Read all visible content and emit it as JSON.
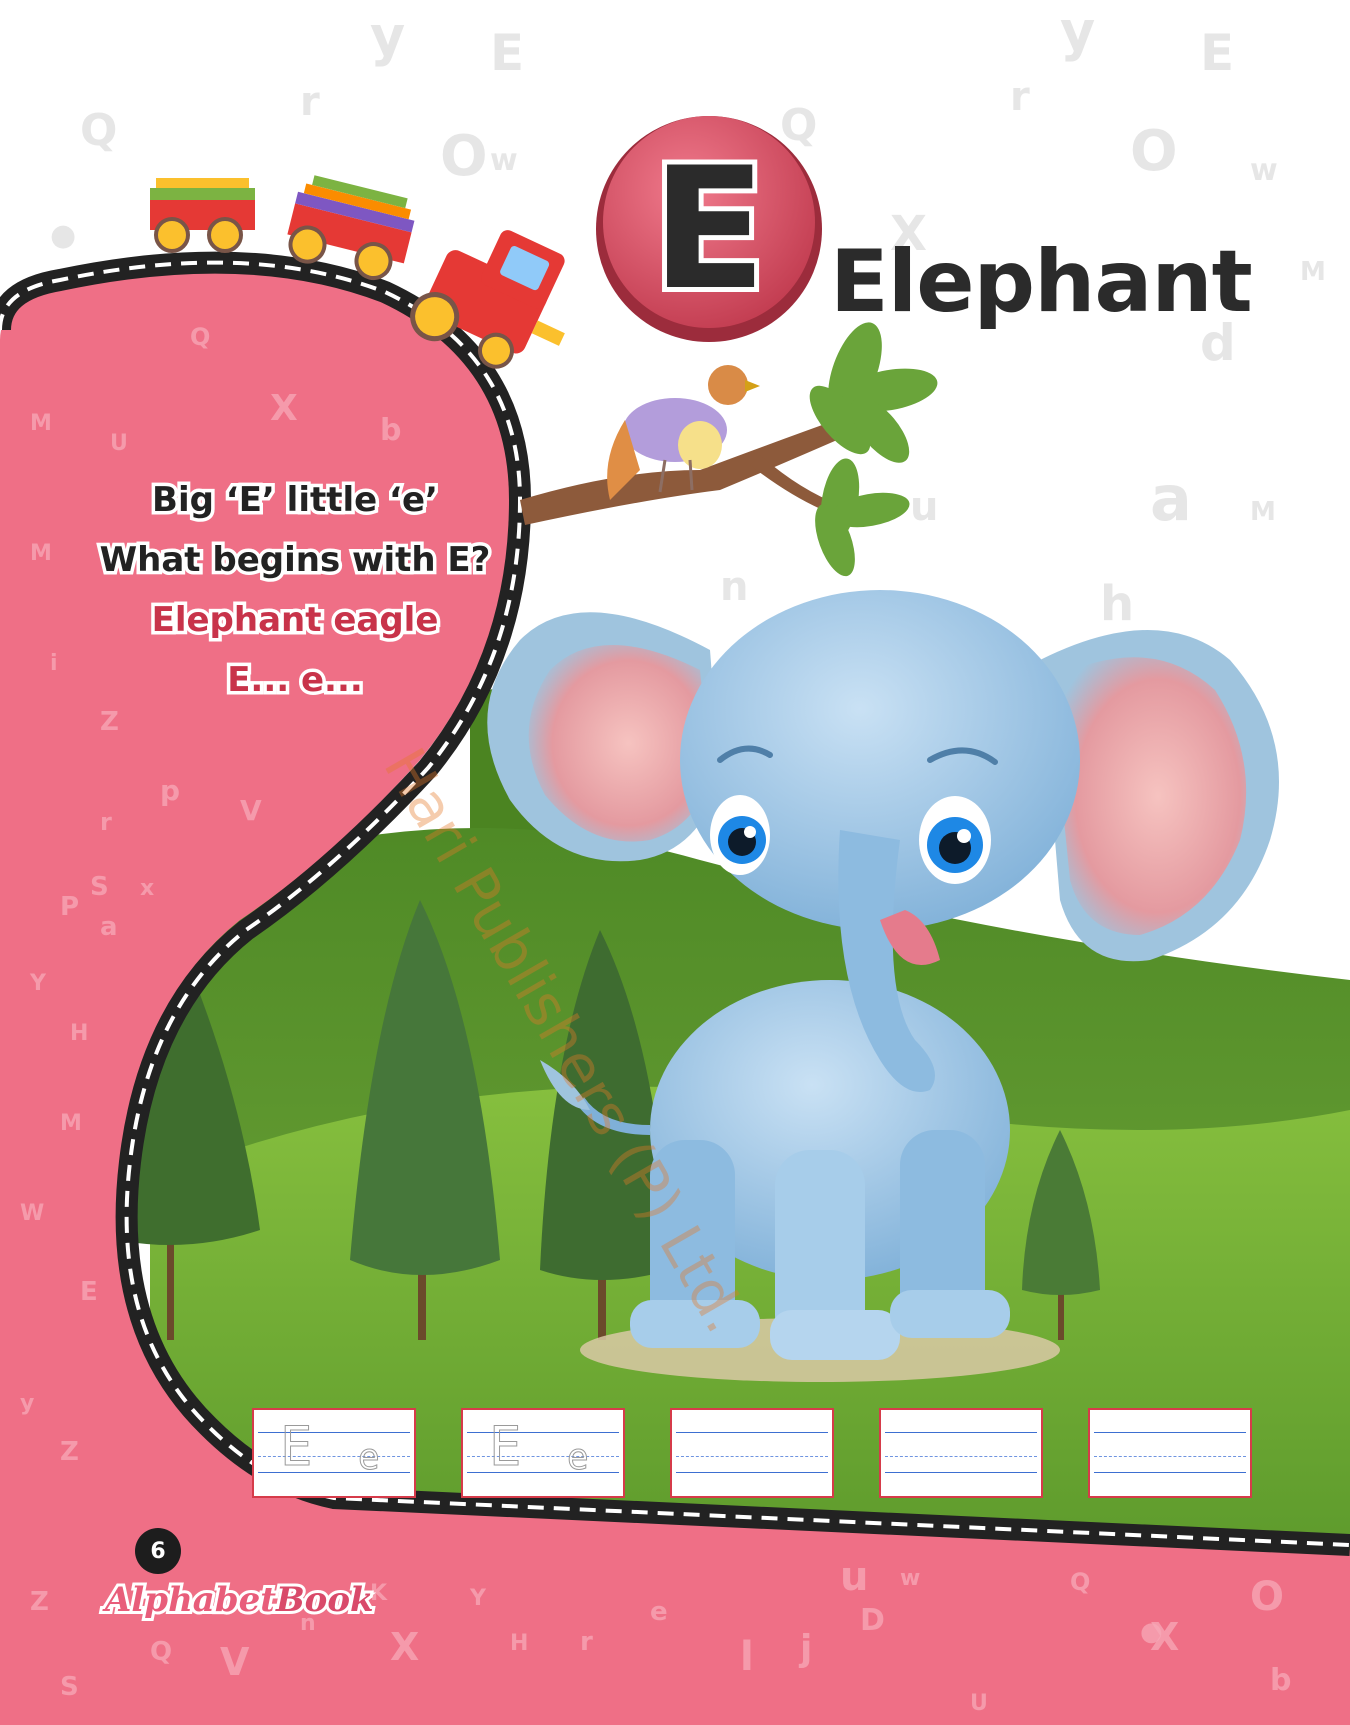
{
  "letter": "E",
  "title": "Elephant",
  "rhyme": {
    "line1": "Big ‘E’ little ‘e’",
    "line2": "What begins with E?",
    "line3": "Elephant  eagle",
    "line4": "E...  e..."
  },
  "page_number": "6",
  "book_logo": {
    "part1": "Alphabet",
    "part2": "Book"
  },
  "watermark": "Hari Publishers (P) Ltd.",
  "practice": {
    "upper": "E",
    "lower": "e"
  },
  "colors": {
    "pink": "#ef6f86",
    "badge": "#d94a5e",
    "grass": "#5c9a32",
    "road": "#222222"
  }
}
